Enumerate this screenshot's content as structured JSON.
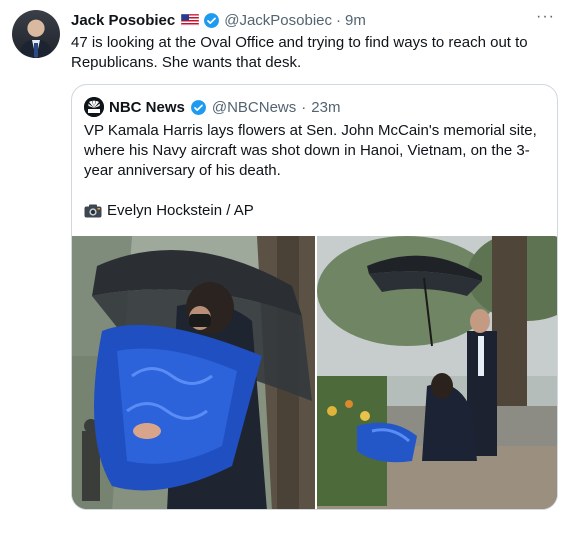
{
  "tweet": {
    "author_name": "Jack Posobiec",
    "author_handle": "@JackPosobiec",
    "separator": "·",
    "time": "9m",
    "more": "···",
    "text": "47 is looking at the Oval Office and trying to find ways to reach out to Republicans. She wants that desk."
  },
  "quoted_tweet": {
    "author_name": "NBC News",
    "author_handle": "@NBCNews",
    "separator": "·",
    "time": "23m",
    "text": "VP Kamala Harris lays flowers at Sen. John McCain's memorial site, where his Navy aircraft was shot down in Hanoi, Vietnam, on the 3-year anniversary of his death.",
    "photo_credit": "Evelyn Hockstein / AP"
  },
  "colors": {
    "verified_blue": "#1d9bf0",
    "secondary_text": "#536471",
    "border": "#cfd9de"
  },
  "icons": [
    "us-flag-icon",
    "verified-badge-icon",
    "more-options-icon",
    "nbc-peacock-logo-icon",
    "camera-icon"
  ]
}
